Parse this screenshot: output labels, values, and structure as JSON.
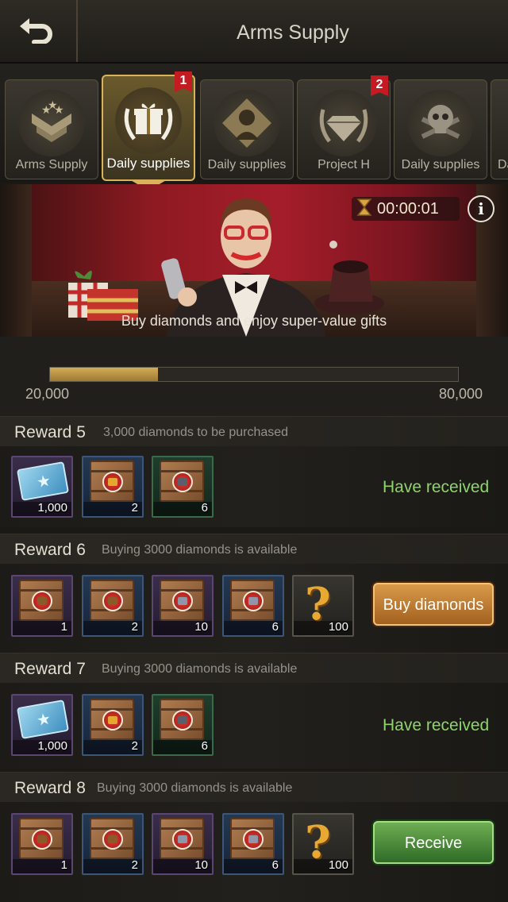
{
  "header": {
    "title": "Arms Supply",
    "back_icon": "back-arrow-icon"
  },
  "tabs": [
    {
      "label": "Arms Supply",
      "icon": "rank-chevron-icon",
      "active": false,
      "badge": ""
    },
    {
      "label": "Daily supplies",
      "icon": "gift-laurel-icon",
      "active": true,
      "badge": "1"
    },
    {
      "label": "Daily supplies",
      "icon": "soldier-silhouette-icon",
      "active": false,
      "badge": ""
    },
    {
      "label": "Project H",
      "icon": "diamond-laurel-icon",
      "active": false,
      "badge": "2"
    },
    {
      "label": "Daily supplies",
      "icon": "skull-crossbones-icon",
      "active": false,
      "badge": ""
    },
    {
      "label": "Da",
      "icon": "",
      "active": false,
      "badge": ""
    }
  ],
  "banner": {
    "timer": "00:00:01",
    "caption": "Buy diamonds and enjoy super-value gifts",
    "info_label": "i"
  },
  "progress": {
    "min_label": "20,000",
    "max_label": "80,000",
    "fraction": 0.264
  },
  "rewards": [
    {
      "title": "Reward 5",
      "condition": "3,000 diamonds to be purchased",
      "items": [
        {
          "kind": "ticket",
          "quality": "purple",
          "count": "1,000"
        },
        {
          "kind": "crate-wheat",
          "quality": "blue",
          "count": "2"
        },
        {
          "kind": "crate-machine",
          "quality": "green",
          "count": "6"
        }
      ],
      "status": "Have received",
      "action": ""
    },
    {
      "title": "Reward 6",
      "condition": "Buying 3000 diamonds is available",
      "items": [
        {
          "kind": "crate-wood",
          "quality": "purple",
          "count": "1"
        },
        {
          "kind": "crate-wood",
          "quality": "blue",
          "count": "2"
        },
        {
          "kind": "crate-steel",
          "quality": "purple",
          "count": "10"
        },
        {
          "kind": "crate-steel",
          "quality": "blue",
          "count": "6"
        },
        {
          "kind": "mystery",
          "quality": "dark",
          "count": "100"
        }
      ],
      "status": "",
      "action": "Buy diamonds"
    },
    {
      "title": "Reward 7",
      "condition": "Buying 3000 diamonds is available",
      "items": [
        {
          "kind": "ticket",
          "quality": "purple",
          "count": "1,000"
        },
        {
          "kind": "crate-wheat",
          "quality": "blue",
          "count": "2"
        },
        {
          "kind": "crate-machine",
          "quality": "green",
          "count": "6"
        }
      ],
      "status": "Have received",
      "action": ""
    },
    {
      "title": "Reward 8",
      "condition": "Buying 3000 diamonds is available",
      "items": [
        {
          "kind": "crate-wood",
          "quality": "purple",
          "count": "1"
        },
        {
          "kind": "crate-wood",
          "quality": "blue",
          "count": "2"
        },
        {
          "kind": "crate-steel",
          "quality": "purple",
          "count": "10"
        },
        {
          "kind": "crate-steel",
          "quality": "blue",
          "count": "6"
        },
        {
          "kind": "mystery",
          "quality": "dark",
          "count": "100"
        }
      ],
      "status": "",
      "action": "Receive"
    }
  ]
}
